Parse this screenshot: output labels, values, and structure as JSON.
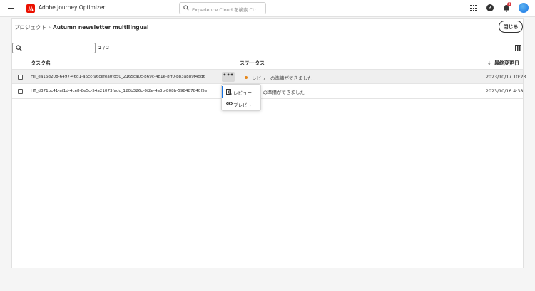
{
  "header": {
    "app_title": "Adobe Journey Optimizer",
    "search_placeholder": "Experience Cloud を検索 Ctr...",
    "help_label": "?",
    "notification_count": "4"
  },
  "breadcrumb": {
    "parent": "プロジェクト",
    "separator": "›",
    "current": "Autumn newsletter multilingual"
  },
  "actions": {
    "close_label": "閉じる"
  },
  "filter": {
    "search_value": "",
    "count_shown": "2",
    "count_sep": " / ",
    "count_total": "2"
  },
  "table": {
    "columns": {
      "task": "タスク名",
      "status": "ステータス",
      "date": "最終変更日",
      "sort_arrow": "↓"
    },
    "rows": [
      {
        "task": "HT_ea16d208-6497-46d1-a6cc-96cefea0fd50_2165ca0c-869c-481e-8ff0-b83a889f4dd6",
        "status": "レビューの準備ができました",
        "date": "2023/10/17  10:23",
        "more_label": "•••"
      },
      {
        "task": "HT_d371bc41-af1d-4ce8-8e5c-54a21073fadc_120b326c-0f2e-4a3b-808b-598487840f5e",
        "status": "ビューの準備ができました",
        "date": "2023/10/16  4:38"
      }
    ],
    "status_color": "#e68619"
  },
  "popover": {
    "items": [
      {
        "label": "レビュー",
        "icon": "review-icon"
      },
      {
        "label": "プレビュー",
        "icon": "eye-icon"
      }
    ]
  },
  "colors": {
    "accent": "#1473e6",
    "brand": "#eb1000",
    "status_pending": "#e68619"
  }
}
